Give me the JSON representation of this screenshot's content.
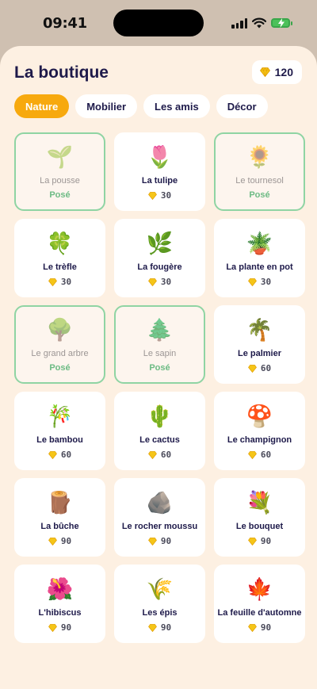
{
  "status_bar": {
    "time": "09:41"
  },
  "header": {
    "title": "La boutique",
    "balance": "120",
    "balance_icon": "gem-icon"
  },
  "tabs": [
    {
      "label": "Nature",
      "active": true
    },
    {
      "label": "Mobilier",
      "active": false
    },
    {
      "label": "Les amis",
      "active": false
    },
    {
      "label": "Décor",
      "active": false
    }
  ],
  "items": [
    {
      "name": "La pousse",
      "emoji": "🌱",
      "placed": true,
      "status": "Posé"
    },
    {
      "name": "La tulipe",
      "emoji": "🌷",
      "placed": false,
      "price": "30"
    },
    {
      "name": "Le tournesol",
      "emoji": "🌻",
      "placed": true,
      "status": "Posé"
    },
    {
      "name": "Le trèfle",
      "emoji": "🍀",
      "placed": false,
      "price": "30"
    },
    {
      "name": "La fougère",
      "emoji": "🌿",
      "placed": false,
      "price": "30"
    },
    {
      "name": "La plante en pot",
      "emoji": "🪴",
      "placed": false,
      "price": "30"
    },
    {
      "name": "Le grand arbre",
      "emoji": "🌳",
      "placed": true,
      "status": "Posé"
    },
    {
      "name": "Le sapin",
      "emoji": "🌲",
      "placed": true,
      "status": "Posé"
    },
    {
      "name": "Le palmier",
      "emoji": "🌴",
      "placed": false,
      "price": "60"
    },
    {
      "name": "Le bambou",
      "emoji": "🎋",
      "placed": false,
      "price": "60"
    },
    {
      "name": "Le cactus",
      "emoji": "🌵",
      "placed": false,
      "price": "60"
    },
    {
      "name": "Le champignon",
      "emoji": "🍄",
      "placed": false,
      "price": "60"
    },
    {
      "name": "La bûche",
      "emoji": "🪵",
      "placed": false,
      "price": "90"
    },
    {
      "name": "Le rocher moussu",
      "emoji": "🪨",
      "placed": false,
      "price": "90"
    },
    {
      "name": "Le bouquet",
      "emoji": "💐",
      "placed": false,
      "price": "90"
    },
    {
      "name": "L'hibiscus",
      "emoji": "🌺",
      "placed": false,
      "price": "90"
    },
    {
      "name": "Les épis",
      "emoji": "🌾",
      "placed": false,
      "price": "90"
    },
    {
      "name": "La feuille d'automne",
      "emoji": "🍁",
      "placed": false,
      "price": "90"
    }
  ],
  "colors": {
    "accent": "#f7a90e",
    "title": "#1e1a4a",
    "background": "#fdf0e2",
    "placed_border": "#8fd4a3",
    "placed_text": "#6dbb84",
    "gem": "#f5c518"
  }
}
